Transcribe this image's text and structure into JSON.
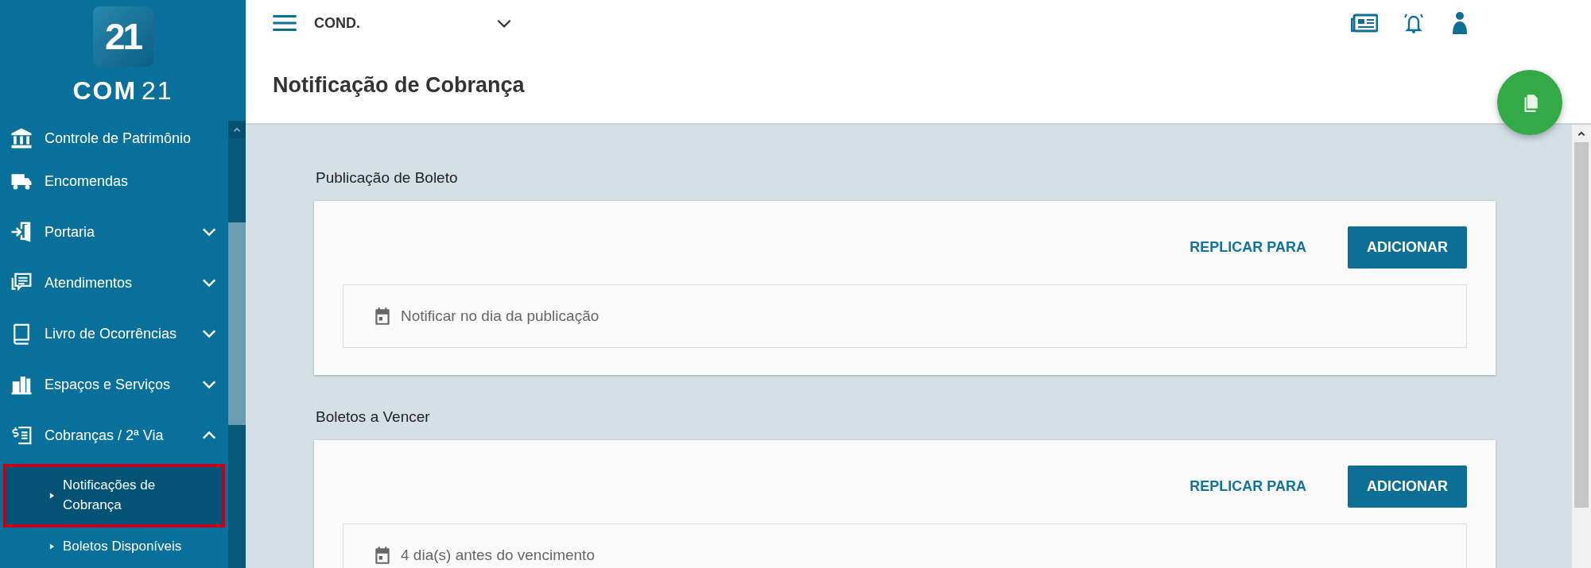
{
  "brand": {
    "badge": "21",
    "name": "COM",
    "name_number": "21"
  },
  "sidebar": {
    "items": [
      {
        "label": "Controle de Patrimônio"
      },
      {
        "label": "Encomendas"
      },
      {
        "label": "Portaria",
        "expanded": false
      },
      {
        "label": "Atendimentos",
        "expanded": false
      },
      {
        "label": "Livro de Ocorrências",
        "expanded": false
      },
      {
        "label": "Espaços e Serviços",
        "expanded": false
      },
      {
        "label": "Cobranças / 2ª Via",
        "expanded": true,
        "children": [
          {
            "label": "Notificações de Cobrança",
            "selected": true
          },
          {
            "label": "Boletos Disponíveis",
            "selected": false
          }
        ]
      }
    ]
  },
  "topbar": {
    "condo": "COND."
  },
  "page_title": "Notificação de Cobrança",
  "sections": [
    {
      "title": "Publicação de Boleto",
      "secondary_action": "REPLICAR PARA",
      "primary_action": "ADICIONAR",
      "rules": [
        {
          "text": "Notificar no dia da publicação"
        }
      ]
    },
    {
      "title": "Boletos a Vencer",
      "secondary_action": "REPLICAR PARA",
      "primary_action": "ADICIONAR",
      "rules": [
        {
          "text": "4 dia(s) antes do vencimento"
        }
      ]
    }
  ]
}
